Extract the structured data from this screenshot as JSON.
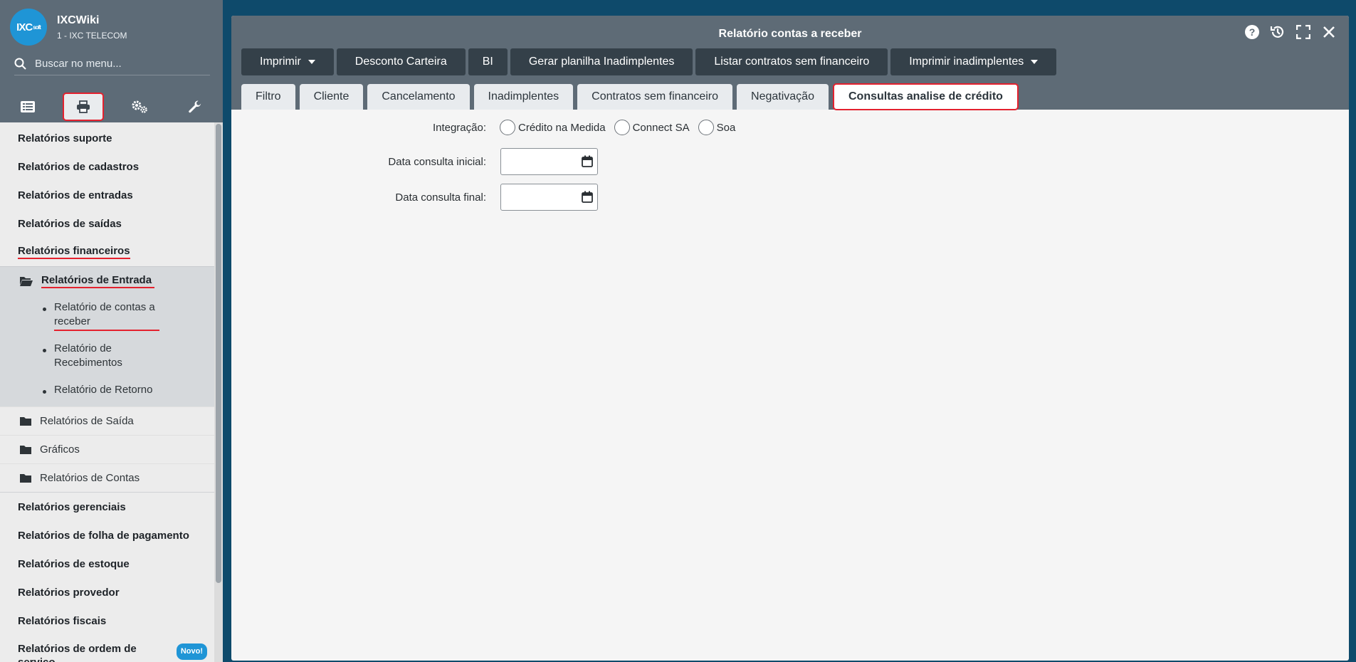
{
  "sidebar": {
    "brand": {
      "logo_text": "IXC",
      "logo_small": "soft",
      "name": "IXCWiki",
      "company": "1 - IXC TELECOM"
    },
    "search": {
      "placeholder": "Buscar no menu..."
    },
    "icon_tabs": [
      "list-icon",
      "print-icon",
      "gears-icon",
      "wrench-icon"
    ],
    "categories_top": [
      "Relatórios suporte",
      "Relatórios de cadastros",
      "Relatórios de entradas",
      "Relatórios de saídas",
      "Relatórios financeiros"
    ],
    "group": {
      "title": "Relatórios de Entrada",
      "items": [
        "Relatório de contas a receber",
        "Relatório de Recebimentos",
        "Relatório de Retorno"
      ]
    },
    "folders": [
      "Relatórios de Saída",
      "Gráficos",
      "Relatórios de Contas"
    ],
    "categories_bottom": [
      "Relatórios gerenciais",
      "Relatórios de folha de pagamento",
      "Relatórios de estoque",
      "Relatórios provedor",
      "Relatórios fiscais",
      "Relatórios de ordem de serviço"
    ],
    "new_badge": "Novo!"
  },
  "window": {
    "title": "Relatório contas a receber",
    "toolbar": [
      "Imprimir",
      "Desconto Carteira",
      "BI",
      "Gerar planilha Inadimplentes",
      "Listar contratos sem financeiro",
      "Imprimir inadimplentes"
    ],
    "tabs": [
      "Filtro",
      "Cliente",
      "Cancelamento",
      "Inadimplentes",
      "Contratos sem financeiro",
      "Negativação",
      "Consultas analise de crédito"
    ],
    "active_tab": "Consultas analise de crédito"
  },
  "form": {
    "integracao_label": "Integração:",
    "integracao_options": [
      "Crédito na Medida",
      "Connect SA",
      "Soa"
    ],
    "data_inicial_label": "Data consulta inicial:",
    "data_inicial_value": "",
    "data_final_label": "Data consulta final:",
    "data_final_value": ""
  },
  "colors": {
    "accent_red": "#e4212e",
    "sidebar": "#5d6b77",
    "toolbar_button": "#344049",
    "brand_blue": "#1f95d6"
  }
}
